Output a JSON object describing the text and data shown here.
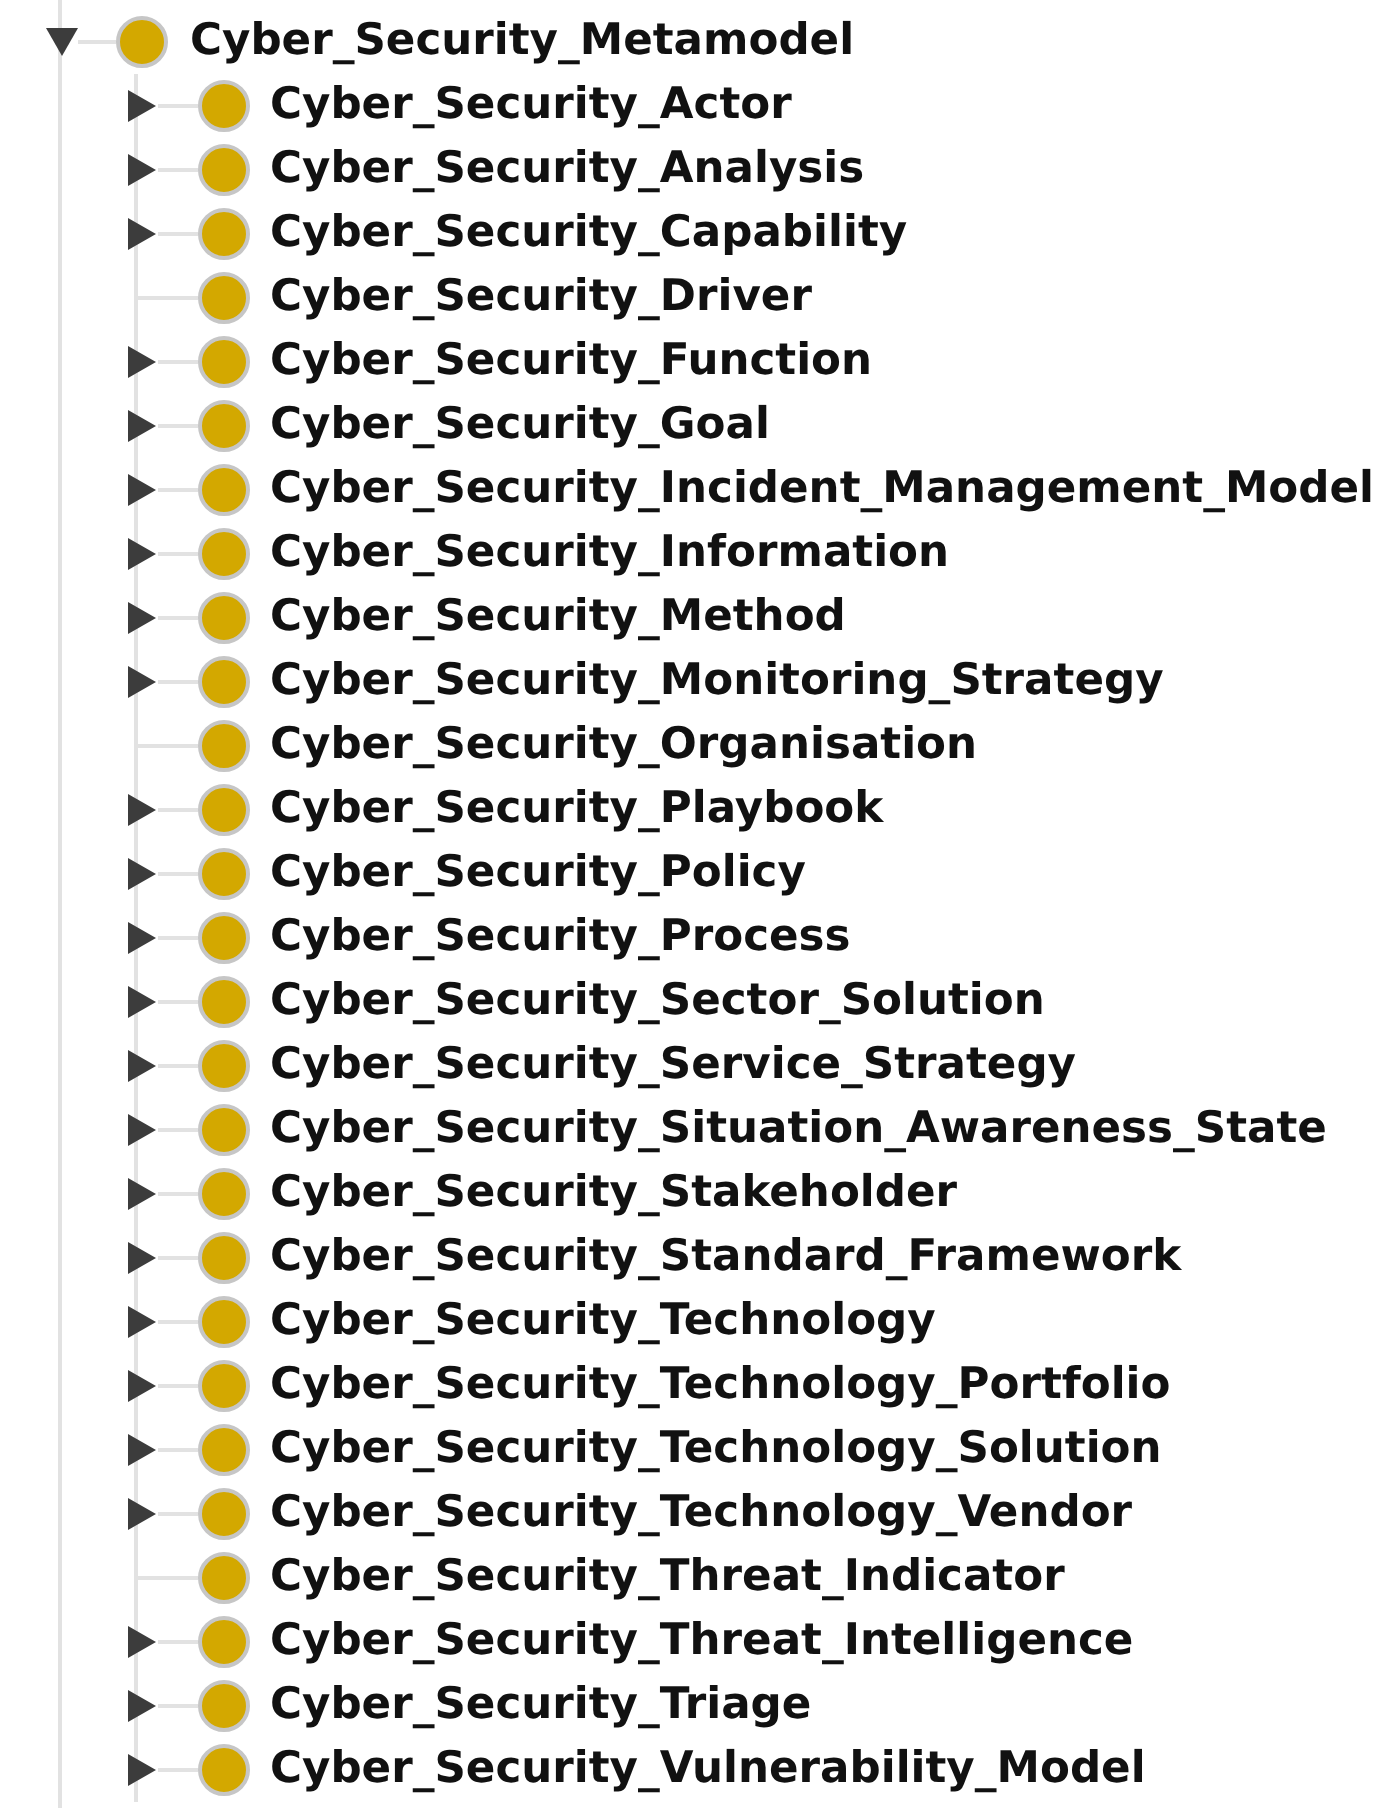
{
  "tree": [
    {
      "label": "Cyber_Security_Metamodel",
      "kind": "branch",
      "expanded": true,
      "children": [
        {
          "label": "Cyber_Security_Actor",
          "kind": "branch",
          "expanded": false
        },
        {
          "label": "Cyber_Security_Analysis",
          "kind": "branch",
          "expanded": false
        },
        {
          "label": "Cyber_Security_Capability",
          "kind": "branch",
          "expanded": false
        },
        {
          "label": "Cyber_Security_Driver",
          "kind": "leaf"
        },
        {
          "label": "Cyber_Security_Function",
          "kind": "branch",
          "expanded": false
        },
        {
          "label": "Cyber_Security_Goal",
          "kind": "branch",
          "expanded": false
        },
        {
          "label": "Cyber_Security_Incident_Management_Model",
          "kind": "branch",
          "expanded": false
        },
        {
          "label": "Cyber_Security_Information",
          "kind": "branch",
          "expanded": false
        },
        {
          "label": "Cyber_Security_Method",
          "kind": "branch",
          "expanded": false
        },
        {
          "label": "Cyber_Security_Monitoring_Strategy",
          "kind": "branch",
          "expanded": false
        },
        {
          "label": "Cyber_Security_Organisation",
          "kind": "leaf"
        },
        {
          "label": "Cyber_Security_Playbook",
          "kind": "branch",
          "expanded": false
        },
        {
          "label": "Cyber_Security_Policy",
          "kind": "branch",
          "expanded": false
        },
        {
          "label": "Cyber_Security_Process",
          "kind": "branch",
          "expanded": false
        },
        {
          "label": "Cyber_Security_Sector_Solution",
          "kind": "branch",
          "expanded": false
        },
        {
          "label": "Cyber_Security_Service_Strategy",
          "kind": "branch",
          "expanded": false
        },
        {
          "label": "Cyber_Security_Situation_Awareness_State",
          "kind": "branch",
          "expanded": false
        },
        {
          "label": "Cyber_Security_Stakeholder",
          "kind": "branch",
          "expanded": false
        },
        {
          "label": "Cyber_Security_Standard_Framework",
          "kind": "branch",
          "expanded": false
        },
        {
          "label": "Cyber_Security_Technology",
          "kind": "branch",
          "expanded": false
        },
        {
          "label": "Cyber_Security_Technology_Portfolio",
          "kind": "branch",
          "expanded": false
        },
        {
          "label": "Cyber_Security_Technology_Solution",
          "kind": "branch",
          "expanded": false
        },
        {
          "label": "Cyber_Security_Technology_Vendor",
          "kind": "branch",
          "expanded": false
        },
        {
          "label": "Cyber_Security_Threat_Indicator",
          "kind": "leaf"
        },
        {
          "label": "Cyber_Security_Threat_Intelligence",
          "kind": "branch",
          "expanded": false
        },
        {
          "label": "Cyber_Security_Triage",
          "kind": "branch",
          "expanded": false
        },
        {
          "label": "Cyber_Security_Vulnerability_Model",
          "kind": "branch",
          "expanded": false
        }
      ]
    }
  ]
}
